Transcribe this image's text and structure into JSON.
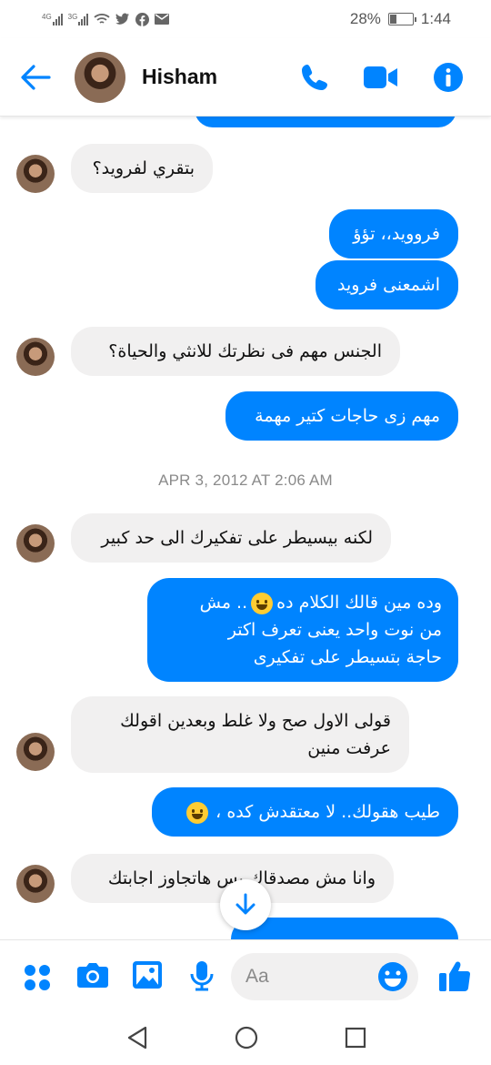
{
  "status_bar": {
    "network_1": "4G",
    "network_2": "3G",
    "battery_percent": "28%",
    "battery_level": 0.28,
    "time": "1:44",
    "icons": [
      "signal-icon",
      "signal-icon",
      "wifi-icon",
      "twitter-icon",
      "facebook-icon",
      "mail-icon",
      "battery-icon"
    ]
  },
  "header": {
    "contact_name": "Hisham",
    "icons": [
      "back-arrow-icon",
      "phone-icon",
      "video-call-icon",
      "info-icon"
    ],
    "accent": "#0084ff"
  },
  "conversation": {
    "messages": [
      {
        "dir": "in",
        "text": "بتقري لفرويد؟"
      },
      {
        "dir": "out",
        "text": "فروويد،، تؤؤ"
      },
      {
        "dir": "out",
        "text": "اشمعنى فرويد"
      },
      {
        "dir": "in",
        "text": "الجنس مهم فى نظرتك للانثي والحياة؟"
      },
      {
        "dir": "out",
        "text": "مهم زى حاجات كتير مهمة"
      },
      {
        "dir": "in",
        "text": "لكنه بيسيطر على تفكيرك الى حد كبير"
      },
      {
        "dir": "out",
        "line1": "وده مين قالك الكلام ده",
        "line1_tail": ".. مش",
        "line2": "من نوت واحد يعنى تعرف اكتر",
        "line3": "حاجة بتسيطر على تفكيرى"
      },
      {
        "dir": "in",
        "line1": "قولى الاول صح ولا غلط وبعدين اقولك",
        "line2": "عرفت منين"
      },
      {
        "dir": "out",
        "text": "طيب هقولك.. لا معتقدش كده ،"
      },
      {
        "dir": "in",
        "text": "وانا مش مصدقاك بس هاتجاوز اجابتك"
      }
    ],
    "timestamp": "APR 3, 2012 AT 2:06 AM",
    "bubble_out_color": "#0084ff",
    "bubble_in_color": "#f1f0f0"
  },
  "composer": {
    "placeholder": "Aa",
    "icons": [
      "apps-icon",
      "camera-icon",
      "gallery-icon",
      "microphone-icon",
      "emoji-icon",
      "thumbs-up-icon"
    ]
  },
  "navbar": {
    "icons": [
      "nav-back-icon",
      "nav-home-icon",
      "nav-recents-icon"
    ]
  }
}
